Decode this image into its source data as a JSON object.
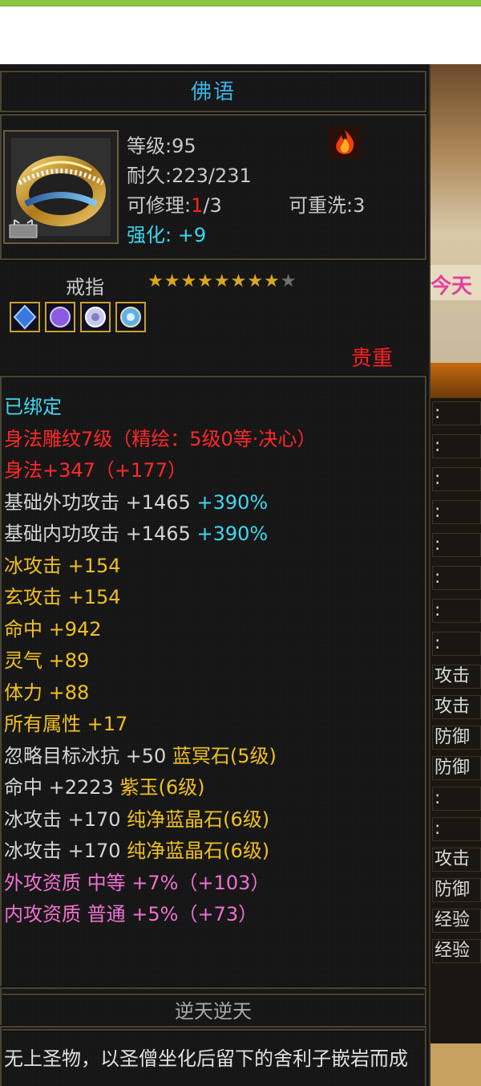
{
  "item": {
    "name": "佛语",
    "level_line": "等级:95",
    "durability_line": "耐久:223/231",
    "repair_prefix": "可修理:",
    "repair_current": "1",
    "repair_suffix": "/3",
    "rewash_line": "可重洗:3",
    "enhance_line": "强化: +9",
    "category": "戒指",
    "stars_filled": "★★★★★★★★",
    "stars_empty": "★",
    "star_count": 8,
    "star_max": 9,
    "rarity": "贵重",
    "owner": "逆天逆天",
    "description": "无上圣物，以圣僧坐化后留下的舍利子嵌岩而成"
  },
  "gems": [
    {
      "icon": "blue-gem-icon",
      "color": "#3a78e0"
    },
    {
      "icon": "purple-gem-icon",
      "color": "#8a5ae0"
    },
    {
      "icon": "crystal-gem-icon",
      "color": "#c8c8f0"
    },
    {
      "icon": "sapphire-gem-icon",
      "color": "#5ab0f0"
    }
  ],
  "stats": [
    {
      "text": "已绑定",
      "color": "c-cyan"
    },
    {
      "text": "身法雕纹7级（精绘：5级0等·决心）",
      "color": "c-red"
    },
    {
      "text": "身法+347（+177）",
      "color": "c-red"
    },
    {
      "text": "基础外功攻击 +1465",
      "extra": " +390%",
      "color": "c-lgray"
    },
    {
      "text": "基础内功攻击 +1465",
      "extra": " +390%",
      "color": "c-lgray"
    },
    {
      "text": "冰攻击 +154",
      "color": "c-yellow"
    },
    {
      "text": "玄攻击 +154",
      "color": "c-yellow"
    },
    {
      "text": "命中 +942",
      "color": "c-yellow"
    },
    {
      "text": "灵气 +89",
      "color": "c-yellow"
    },
    {
      "text": "体力 +88",
      "color": "c-yellow"
    },
    {
      "text": "所有属性 +17",
      "color": "c-yellow"
    },
    {
      "text": "忽略目标冰抗 +50",
      "extra": " 蓝冥石(5级)",
      "color": "c-lgray"
    },
    {
      "text": "命中 +2223",
      "extra": " 紫玉(6级)",
      "color": "c-lgray"
    },
    {
      "text": "冰攻击 +170",
      "extra": " 纯净蓝晶石(6级)",
      "color": "c-lgray"
    },
    {
      "text": "冰攻击 +170",
      "extra": " 纯净蓝晶石(6级)",
      "color": "c-lgray"
    },
    {
      "text": "外攻资质",
      "extra": "  中等 +7%（+103）",
      "color": "c-pink"
    },
    {
      "text": "内攻资质",
      "extra": "  普通 +5%（+73）",
      "color": "c-pink"
    }
  ],
  "side": {
    "banner": "今天",
    "rows": [
      ":",
      ":",
      ":",
      ":",
      ":",
      ":",
      ":",
      ":",
      "攻击",
      "攻击",
      "防御",
      "防御",
      ":",
      ":",
      "攻击",
      "防御",
      "经验",
      "经验"
    ]
  }
}
